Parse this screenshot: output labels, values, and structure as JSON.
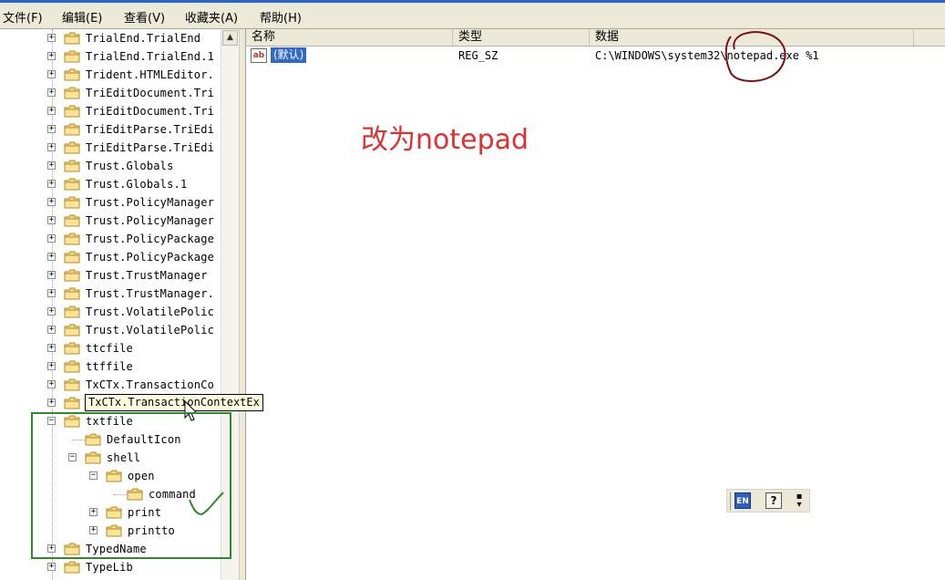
{
  "menu": [
    "文件(F)",
    "编辑(E)",
    "查看(V)",
    "收藏夹(A)",
    "帮助(H)"
  ],
  "tree": {
    "items": [
      {
        "label": "TrialEnd.TrialEnd",
        "expander": "+"
      },
      {
        "label": "TrialEnd.TrialEnd.1",
        "expander": "+"
      },
      {
        "label": "Trident.HTMLEditor.",
        "expander": "+"
      },
      {
        "label": "TriEditDocument.Tri",
        "expander": "+"
      },
      {
        "label": "TriEditDocument.Tri",
        "expander": "+"
      },
      {
        "label": "TriEditParse.TriEdi",
        "expander": "+"
      },
      {
        "label": "TriEditParse.TriEdi",
        "expander": "+"
      },
      {
        "label": "Trust.Globals",
        "expander": "+"
      },
      {
        "label": "Trust.Globals.1",
        "expander": "+"
      },
      {
        "label": "Trust.PolicyManager",
        "expander": "+"
      },
      {
        "label": "Trust.PolicyManager",
        "expander": "+"
      },
      {
        "label": "Trust.PolicyPackage",
        "expander": "+"
      },
      {
        "label": "Trust.PolicyPackage",
        "expander": "+"
      },
      {
        "label": "Trust.TrustManager",
        "expander": "+"
      },
      {
        "label": "Trust.TrustManager.",
        "expander": "+"
      },
      {
        "label": "Trust.VolatilePolic",
        "expander": "+"
      },
      {
        "label": "Trust.VolatilePolic",
        "expander": "+"
      },
      {
        "label": "ttcfile",
        "expander": "+"
      },
      {
        "label": "ttffile",
        "expander": "+"
      },
      {
        "label": "TxCTx.TransactionCo",
        "expander": "+"
      },
      {
        "label": "",
        "expander": "+"
      },
      {
        "label": "txtfile",
        "expander": "−"
      },
      {
        "label": "DefaultIcon",
        "expander": ""
      },
      {
        "label": "shell",
        "expander": "−"
      },
      {
        "label": "open",
        "expander": "−"
      },
      {
        "label": "command",
        "expander": ""
      },
      {
        "label": "print",
        "expander": "+"
      },
      {
        "label": "printto",
        "expander": "+"
      },
      {
        "label": "TypedName",
        "expander": "+"
      },
      {
        "label": "TypeLib",
        "expander": "+"
      }
    ],
    "tooltip": "TxCTx.TransactionContextEx"
  },
  "list": {
    "columns": [
      "名称",
      "类型",
      "数据"
    ],
    "rows": [
      {
        "icon": "ab",
        "name": "(默认)",
        "type": "REG_SZ",
        "data": "C:\\WINDOWS\\system32\\notepad.exe %1"
      }
    ]
  },
  "annotation": "改为notepad",
  "langbar": {
    "lang": "EN",
    "help": "?"
  },
  "colors": {
    "selection": "#316ac5",
    "annotation": "#e03030",
    "box": "#2f8a2f",
    "circle": "#7a1010"
  },
  "icons": [
    "folder-icon",
    "string-value-icon",
    "mouse-cursor-icon",
    "checkmark-annotation",
    "lang-help-icon"
  ]
}
